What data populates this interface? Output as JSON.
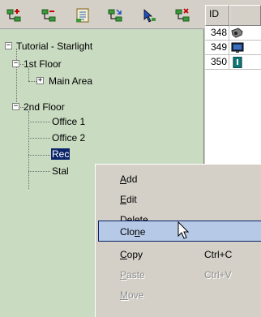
{
  "toolbar": {
    "buttons": [
      {
        "icon": "add-child-node-icon"
      },
      {
        "icon": "remove-node-icon"
      },
      {
        "icon": "properties-list-icon"
      },
      {
        "icon": "move-node-icon"
      },
      {
        "icon": "pointer-icon"
      },
      {
        "icon": "delete-node-icon"
      }
    ]
  },
  "tree": {
    "root": "Tutorial - Starlight",
    "floor1": "1st Floor",
    "main_area": "Main Area",
    "floor2": "2nd Floor",
    "office1": "Office 1",
    "office2": "Office 2",
    "reception": "Rec",
    "storage": "Stal"
  },
  "grid": {
    "header_id": "ID",
    "rows": [
      {
        "id": "348",
        "icon": "camera-icon"
      },
      {
        "id": "349",
        "icon": "monitor-icon"
      },
      {
        "id": "350",
        "icon": "door-reader-icon"
      }
    ]
  },
  "context_menu": {
    "add": {
      "pre": "",
      "mnemonic": "A",
      "post": "dd"
    },
    "edit": {
      "pre": "",
      "mnemonic": "E",
      "post": "dit"
    },
    "delete": {
      "pre": "",
      "mnemonic": "D",
      "post": "elete"
    },
    "clone": {
      "pre": "Clo",
      "mnemonic": "n",
      "post": "e"
    },
    "copy": {
      "pre": "",
      "mnemonic": "C",
      "post": "opy",
      "shortcut": "Ctrl+C"
    },
    "paste": {
      "pre": "",
      "mnemonic": "P",
      "post": "aste",
      "shortcut": "Ctrl+V"
    },
    "move": {
      "pre": "",
      "mnemonic": "M",
      "post": "ove"
    }
  },
  "colors": {
    "tree_background": "#c9dbc1",
    "selection": "#0a246a",
    "menu_highlight": "#b6c9e6"
  }
}
